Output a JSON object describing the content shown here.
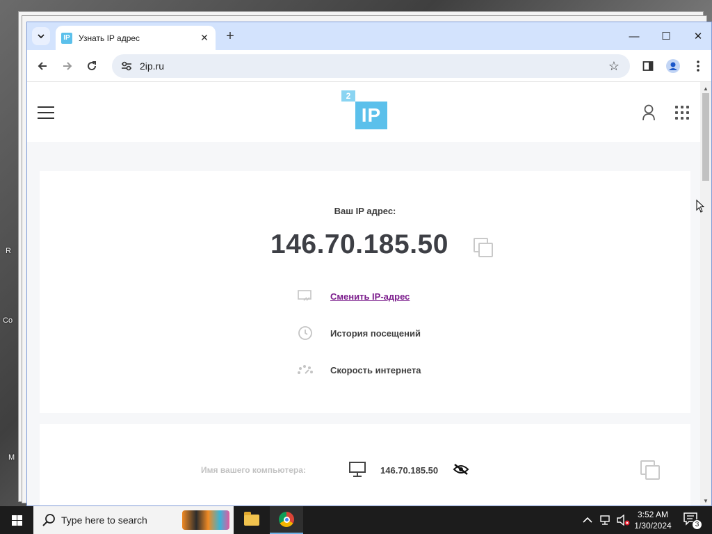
{
  "desktop": {
    "edge_texts": [
      "R",
      "Co",
      "M"
    ]
  },
  "browser": {
    "tab": {
      "favicon_text": "IP",
      "title": "Узнать IP адрес"
    },
    "address_bar": {
      "url": "2ip.ru"
    }
  },
  "site": {
    "logo": {
      "small": "2",
      "big": "IP"
    },
    "main_card": {
      "ip_label": "Ваш IP адрес:",
      "ip_value": "146.70.185.50",
      "actions": [
        {
          "label": "Сменить IP-адрес",
          "icon": "change-ip-icon"
        },
        {
          "label": "История посещений",
          "icon": "history-icon"
        },
        {
          "label": "Скорость интернета",
          "icon": "speedometer-icon"
        }
      ]
    },
    "second_card": {
      "computer_name_label": "Имя вашего компьютера:",
      "computer_name_value": "146.70.185.50"
    }
  },
  "taskbar": {
    "search_placeholder": "Type here to search",
    "clock_time": "3:52 AM",
    "clock_date": "1/30/2024",
    "notification_count": "3"
  },
  "colors": {
    "brand": "#5bc0eb",
    "link": "#7b1c8c",
    "tabstrip": "#d3e3fd"
  }
}
